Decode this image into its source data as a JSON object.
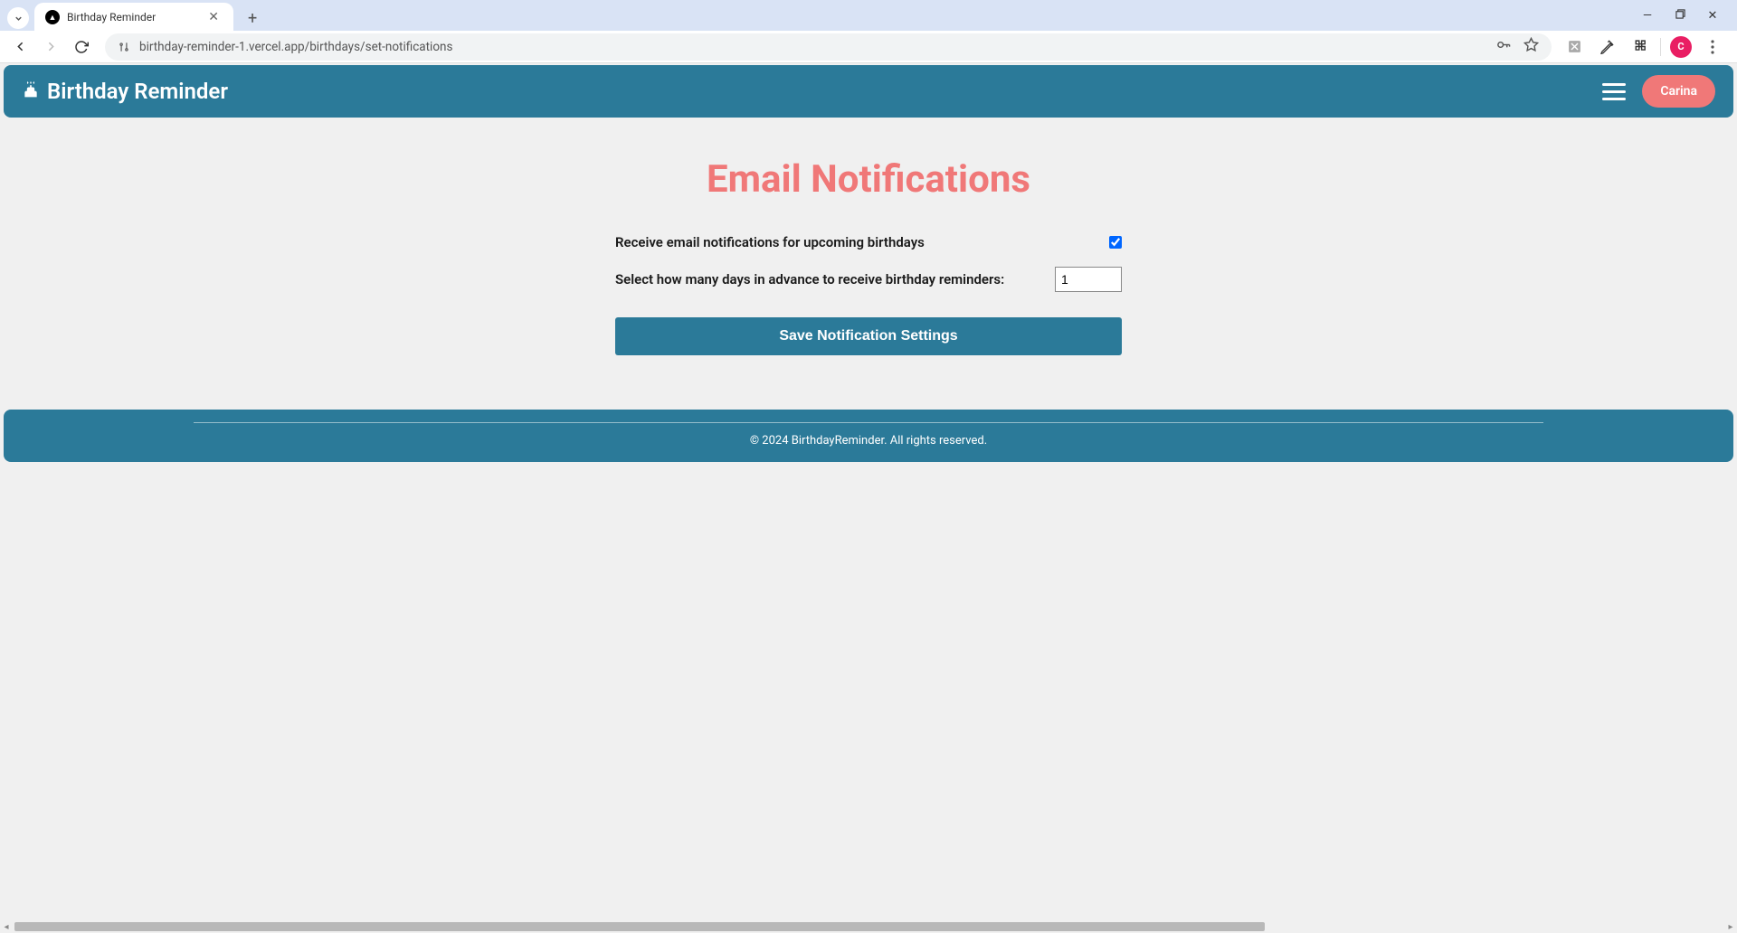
{
  "browser": {
    "tab_title": "Birthday Reminder",
    "url": "birthday-reminder-1.vercel.app/birthdays/set-notifications",
    "profile_initial": "C"
  },
  "header": {
    "app_name": "Birthday Reminder",
    "user_name": "Carina"
  },
  "page": {
    "heading": "Email Notifications",
    "receive_label": "Receive email notifications for upcoming birthdays",
    "receive_checked": "true",
    "days_label": "Select how many days in advance to receive birthday reminders:",
    "days_value": "1",
    "save_button": "Save Notification Settings"
  },
  "footer": {
    "text": "© 2024 BirthdayReminder. All rights reserved."
  }
}
